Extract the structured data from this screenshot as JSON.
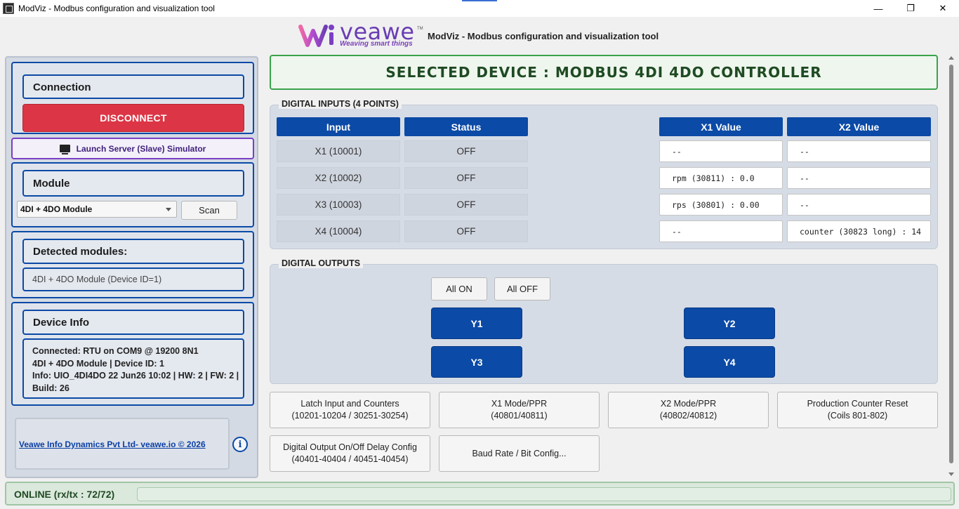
{
  "window": {
    "title": "ModViz - Modbus configuration and visualization tool",
    "controls": {
      "minimize": "—",
      "restore": "❐",
      "close": "✕"
    }
  },
  "header": {
    "logo_text": "veawe",
    "logo_tagline": "Weaving smart things",
    "logo_tm": "TM",
    "title": "ModViz - Modbus configuration and visualization tool"
  },
  "connection": {
    "title": "Connection",
    "disconnect_label": "DISCONNECT"
  },
  "simulator": {
    "label": "Launch Server (Slave) Simulator"
  },
  "module": {
    "title": "Module",
    "selected": "4DI + 4DO Module",
    "scan_label": "Scan"
  },
  "detected": {
    "title": "Detected modules:",
    "item": "4DI + 4DO Module (Device ID=1)"
  },
  "device_info": {
    "title": "Device Info",
    "line1": "Connected: RTU on COM9 @ 19200 8N1",
    "line2": "4DI + 4DO Module | Device ID: 1",
    "line3": "Info: UIO_4DI4DO 22 Jun26 10:02 | HW: 2 | FW: 2 | Build: 26"
  },
  "footer": {
    "link": "Veawe Info Dynamics Pvt Ltd- veawe.io © 2026",
    "info_icon": "i"
  },
  "selected_device": "SELECTED DEVICE : MODBUS 4DI 4DO CONTROLLER",
  "digital_inputs": {
    "label": "DIGITAL INPUTS (4 POINTS)",
    "headers": {
      "input": "Input",
      "status": "Status",
      "x1": "X1 Value",
      "x2": "X2 Value"
    },
    "rows": [
      {
        "input": "X1 (10001)",
        "status": "OFF",
        "x1": "--",
        "x2": "--"
      },
      {
        "input": "X2 (10002)",
        "status": "OFF",
        "x1": "rpm (30811) : 0.0",
        "x2": "--"
      },
      {
        "input": "X3 (10003)",
        "status": "OFF",
        "x1": "rps (30801) : 0.00",
        "x2": "--"
      },
      {
        "input": "X4 (10004)",
        "status": "OFF",
        "x1": "--",
        "x2": "counter (30823 long) : 14"
      }
    ]
  },
  "digital_outputs": {
    "label": "DIGITAL OUTPUTS",
    "all_on": "All ON",
    "all_off": "All OFF",
    "outputs": [
      "Y1",
      "Y2",
      "Y3",
      "Y4"
    ]
  },
  "config_buttons": [
    {
      "line1": "Latch Input and Counters",
      "line2": "(10201-10204 / 30251-30254)"
    },
    {
      "line1": "X1 Mode/PPR",
      "line2": "(40801/40811)"
    },
    {
      "line1": "X2 Mode/PPR",
      "line2": "(40802/40812)"
    },
    {
      "line1": "Production Counter Reset",
      "line2": "(Coils 801-802)"
    },
    {
      "line1": "Digital Output On/Off Delay Config",
      "line2": "(40401-40404 / 40451-40454)"
    },
    {
      "line1": "Baud Rate / Bit Config...",
      "line2": ""
    }
  ],
  "status": {
    "text": "ONLINE (rx/tx : 72/72)"
  },
  "colors": {
    "primary": "#0b4aa6",
    "danger": "#dc3545",
    "success": "#3aa34a",
    "accent_purple": "#7a3fc2"
  }
}
